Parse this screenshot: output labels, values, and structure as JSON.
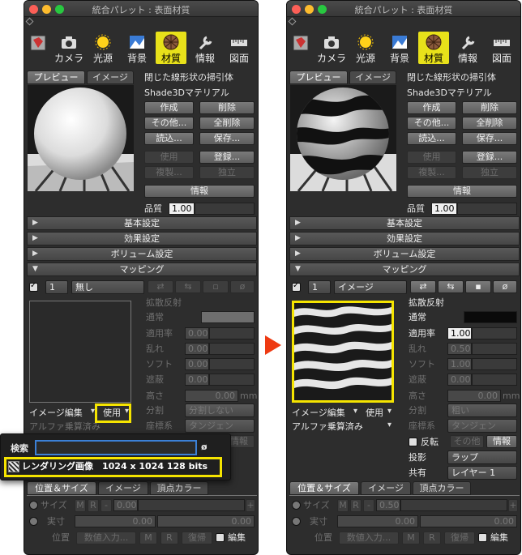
{
  "window": {
    "title": "統合パレット : 表面材質"
  },
  "toolbar": {
    "items": [
      "カメラ",
      "光源",
      "背景",
      "材質",
      "情報",
      "図面"
    ]
  },
  "preview_tabs": [
    "プレビュー",
    "イメージ"
  ],
  "material": {
    "title": "閉じた線形状の掃引体",
    "name": "Shade3Dマテリアル"
  },
  "buttons": {
    "create": "作成",
    "delete": "削除",
    "other": "その他...",
    "delete_all": "全削除",
    "load": "読込...",
    "save": "保存...",
    "use": "使用",
    "register": "登録...",
    "duplicate": "複製...",
    "independent": "独立",
    "info": "情報"
  },
  "quality": {
    "label": "品質",
    "value": "1.00"
  },
  "sections": {
    "basic": "基本設定",
    "effect": "効果設定",
    "volume": "ボリューム設定",
    "mapping": "マッピング"
  },
  "mapping_left": {
    "index": "1",
    "type": "無し",
    "channel": "拡散反射",
    "mode": "通常",
    "rate": "適用率",
    "rate_value": "0.00",
    "noise": "乱れ",
    "noise_value": "0.00",
    "soft": "ソフト",
    "soft_value": "0.00",
    "occlusion": "遮蔽",
    "occlusion_value": "0.00",
    "height": "高さ",
    "height_value": "0.00",
    "height_unit": "mm",
    "divide": "分割",
    "divide_value": "分割しない",
    "coord": "座標系",
    "coord_value": "タンジェン",
    "image_edit": "イメージ編集",
    "use_popup": "使用",
    "alpha": "アルファ乗算済み",
    "info_btn": "情報"
  },
  "mapping_right": {
    "index": "1",
    "type": "イメージ",
    "channel": "拡散反射",
    "mode": "通常",
    "rate": "適用率",
    "rate_value": "1.00",
    "noise": "乱れ",
    "noise_value": "0.50",
    "soft": "ソフト",
    "soft_value": "1.00",
    "occlusion": "遮蔽",
    "occlusion_value": "0.00",
    "height": "高さ",
    "height_value": "0.00",
    "height_unit": "mm",
    "divide": "分割",
    "divide_value": "粗い",
    "coord": "座標系",
    "coord_value": "タンジェン",
    "image_edit": "イメージ編集",
    "use_popup": "使用",
    "alpha": "アルファ乗算済み",
    "flip": "反転",
    "other": "その他",
    "info_btn": "情報",
    "projection": "投影",
    "projection_value": "ラップ",
    "shared": "共有",
    "shared_value": "レイヤー 1"
  },
  "search": {
    "label": "検索",
    "result": "レンダリング画像　1024 x 1024 128 bits"
  },
  "bottom_tabs": [
    "位置＆サイズ",
    "イメージ",
    "頂点カラー"
  ],
  "bottom": {
    "size": "サイズ",
    "m": "M",
    "r": "R",
    "minus": "-",
    "size_val_left": "0.00",
    "size_val_right": "0.50",
    "plus": "+",
    "actual": "実寸",
    "actual_val": "0.00",
    "actual_val2": "0.00",
    "position": "位置",
    "numeric": "数値入力...",
    "restore": "復帰",
    "edit": "編集"
  },
  "colors": {
    "highlight": "#f5e400",
    "arrow": "#ee3a12",
    "material_tab": "#e8e11a"
  },
  "glyphs": {
    "arrow_right": "▶",
    "arrow_down": "▼",
    "dropdown": "▾",
    "clear": "ø"
  }
}
